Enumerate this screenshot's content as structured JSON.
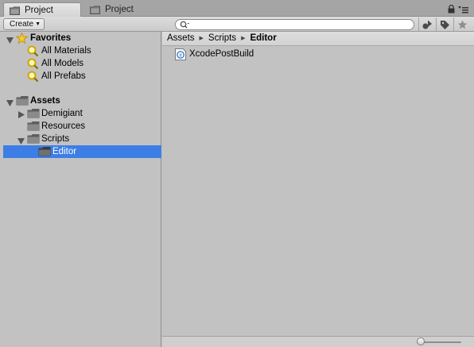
{
  "tabs": [
    {
      "label": "Project",
      "icon": "folder-icon",
      "active": true
    },
    {
      "label": "Project",
      "icon": "folder-icon",
      "active": false
    }
  ],
  "toolbar": {
    "create_label": "Create",
    "search_placeholder": ""
  },
  "sidebar": {
    "favorites": {
      "label": "Favorites",
      "items": [
        {
          "label": "All Materials",
          "icon": "search-icon"
        },
        {
          "label": "All Models",
          "icon": "search-icon"
        },
        {
          "label": "All Prefabs",
          "icon": "search-icon"
        }
      ]
    },
    "assets": {
      "label": "Assets",
      "items": [
        {
          "label": "Demigiant",
          "expandable": true
        },
        {
          "label": "Resources",
          "expandable": false
        },
        {
          "label": "Scripts",
          "expanded": true
        },
        {
          "label": "Editor",
          "selected": true
        }
      ]
    }
  },
  "breadcrumb": [
    "Assets",
    "Scripts",
    "Editor"
  ],
  "assets_list": [
    {
      "name": "XcodePostBuild",
      "icon": "csharp-script-icon"
    }
  ],
  "colors": {
    "selection": "#3d7ee6",
    "panel": "#c2c2c2"
  },
  "zoom_slider": {
    "value": 0
  }
}
